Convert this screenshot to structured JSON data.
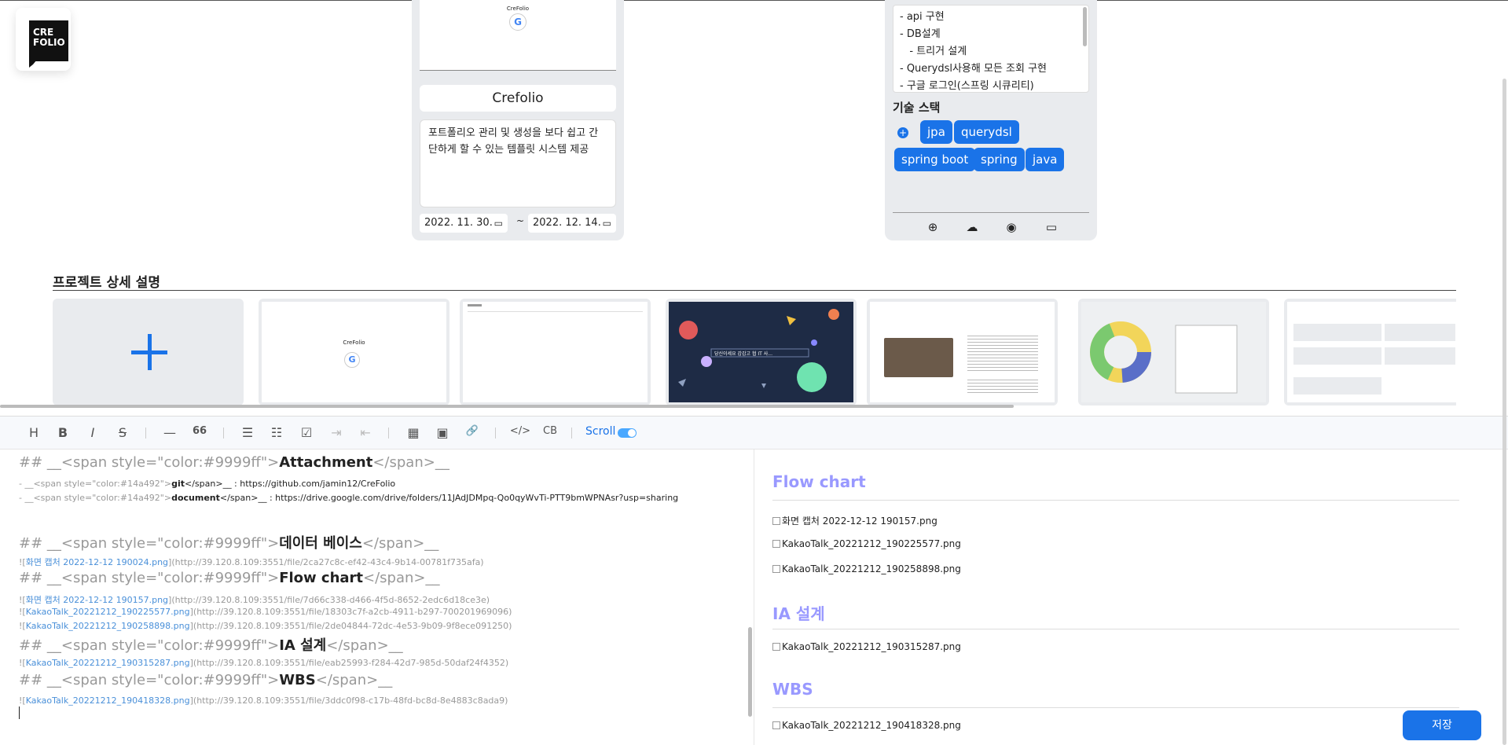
{
  "logo": {
    "line1": "CRE",
    "line2": "FOLIO"
  },
  "project_card": {
    "thumb_title": "CreFolio",
    "thumb_google": "G",
    "title": "Crefolio",
    "description": "포트폴리오 관리 및 생성을 보다 쉽고 간단하게 할 수 있는 템플릿 시스템 제공",
    "start_date": "2022. 11. 30.",
    "separator": "~",
    "end_date": "2022. 12. 14.",
    "calendar_glyph": "▭"
  },
  "tech_card": {
    "notes": [
      "- api 구현",
      "- DB설계",
      "   - 트리거 설계",
      "- Querydsl사용해 모든 조회 구현",
      "- 구글 로그인(스프링 시큐리티)"
    ],
    "heading": "기술 스택",
    "add_glyph": "+",
    "chips": [
      "jpa",
      "querydsl",
      "spring boot",
      "spring",
      "java"
    ],
    "bottom_icons": [
      "plus-circle-icon",
      "cloud-icon",
      "github-icon",
      "monitor-icon"
    ],
    "bottom_glyphs": [
      "⊕",
      "☁",
      "◉",
      "▭"
    ]
  },
  "detail": {
    "title": "프로젝트 상세 설명",
    "slide_names": [
      "google-login-screen",
      "blank-page",
      "dark-space-intro",
      "profile-page",
      "donut-chart-page",
      "grid-layout-page"
    ],
    "slide_texts": {
      "google_title": "CreFolio",
      "google_g": "G",
      "dark_caption": "당신이세요 갑갑고 협 IT 사..."
    }
  },
  "toolbar": {
    "buttons": [
      {
        "name": "heading-button",
        "glyph": "H"
      },
      {
        "name": "bold-button",
        "glyph": "B"
      },
      {
        "name": "italic-button",
        "glyph": "I"
      },
      {
        "name": "strike-button",
        "glyph": "S"
      },
      {
        "name": "hr-button",
        "glyph": "—"
      },
      {
        "name": "quote-button",
        "glyph": "66"
      },
      {
        "name": "bullet-list-button",
        "glyph": "☰"
      },
      {
        "name": "ordered-list-button",
        "glyph": "☷"
      },
      {
        "name": "task-list-button",
        "glyph": "☑"
      },
      {
        "name": "indent-button",
        "glyph": "⇥"
      },
      {
        "name": "outdent-button",
        "glyph": "⇤"
      },
      {
        "name": "table-button",
        "glyph": "▦"
      },
      {
        "name": "image-button",
        "glyph": "▣"
      },
      {
        "name": "link-button",
        "glyph": "🔗"
      },
      {
        "name": "code-button",
        "glyph": "</>"
      },
      {
        "name": "codeblock-button",
        "glyph": "CB"
      }
    ],
    "scroll_label": "Scroll"
  },
  "markdown": {
    "h_attachment": {
      "pre": "## __<span style=\"color:#9999ff\">",
      "title": "Attachment",
      "post": "</span>__"
    },
    "git_line": {
      "pre": "- __<span style=\"color:#14a492\">",
      "key": "git",
      "post": "</span>__ : https://github.com/jamin12/CreFolio"
    },
    "doc_line": {
      "pre": "- __<span style=\"color:#14a492\">",
      "key": "document",
      "post": "</span>__ : https://drive.google.com/drive/folders/11JAdJDMpq-Qo0qyWvTi-PTT9bmWPNAsr?usp=sharing"
    },
    "h_db": {
      "pre": "## __<span style=\"color:#9999ff\">",
      "title": "데이터 베이스",
      "post": "</span>__"
    },
    "img_db": {
      "alt": "화면 캡처 2022-12-12 190024.png",
      "url": "(http://39.120.8.109:3551/file/2ca27c8c-ef42-43c4-9b14-00781f735afa)"
    },
    "h_flow": {
      "pre": "## __<span style=\"color:#9999ff\">",
      "title": "Flow chart",
      "post": "</span>__"
    },
    "img_flow1": {
      "alt": "화면 캡처 2022-12-12 190157.png",
      "url": "(http://39.120.8.109:3551/file/7d66c338-d466-4f5d-8652-2edc6d18ce3e)"
    },
    "img_flow2": {
      "alt": "KakaoTalk_20221212_190225577.png",
      "url": "(http://39.120.8.109:3551/file/18303c7f-a2cb-4911-b297-700201969096)"
    },
    "img_flow3": {
      "alt": "KakaoTalk_20221212_190258898.png",
      "url": "(http://39.120.8.109:3551/file/2de04844-72dc-4e53-9b09-9f8ece091250)"
    },
    "h_ia": {
      "pre": "## __<span style=\"color:#9999ff\">",
      "title": "IA 설계",
      "post": "</span>__"
    },
    "img_ia": {
      "alt": "KakaoTalk_20221212_190315287.png",
      "url": "(http://39.120.8.109:3551/file/eab25993-f284-42d7-985d-50daf24f4352)"
    },
    "h_wbs": {
      "pre": "## __<span style=\"color:#9999ff\">",
      "title": "WBS",
      "post": "</span>__"
    },
    "img_wbs": {
      "alt": "KakaoTalk_20221212_190418328.png",
      "url": "(http://39.120.8.109:3551/file/3ddc0f98-c17b-48fd-bc8d-8e4883c8ada9)"
    },
    "bang": "!"
  },
  "preview": {
    "flow_title": "Flow chart",
    "flow_images": [
      "화면 캡처 2022-12-12 190157.png",
      "KakaoTalk_20221212_190225577.png",
      "KakaoTalk_20221212_190258898.png"
    ],
    "ia_title": "IA 설계",
    "ia_images": [
      "KakaoTalk_20221212_190315287.png"
    ],
    "wbs_title": "WBS",
    "wbs_images": [
      "KakaoTalk_20221212_190418328.png"
    ]
  },
  "save_label": "저장",
  "colors": {
    "accent": "#1a73e8",
    "heading_purple": "#9999ff",
    "card_bg": "#e9ebee"
  }
}
